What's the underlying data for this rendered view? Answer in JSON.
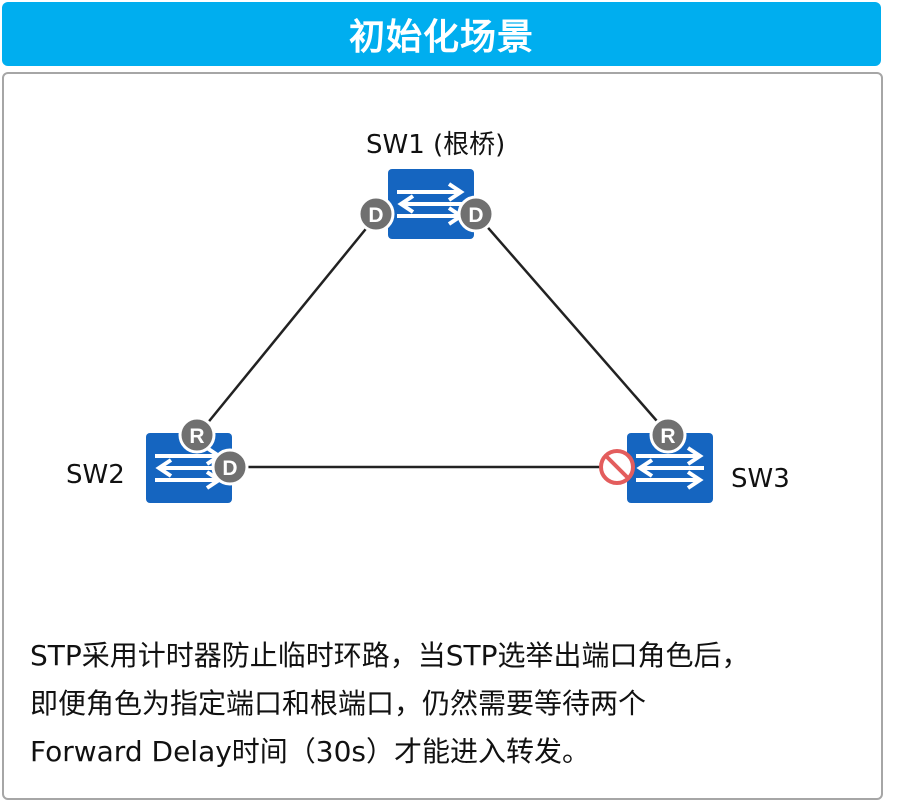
{
  "header": {
    "title": "初始化场景"
  },
  "diagram": {
    "switches": [
      {
        "id": "sw1",
        "label": "SW1 (根桥)",
        "icon": "switch-icon"
      },
      {
        "id": "sw2",
        "label": "SW2",
        "icon": "switch-icon"
      },
      {
        "id": "sw3",
        "label": "SW3",
        "icon": "switch-icon"
      }
    ],
    "port_roles": {
      "designated": "D",
      "root": "R",
      "blocked_icon": "blocked-icon"
    },
    "colors": {
      "switch": "#1565C0",
      "port_badge": "#707070",
      "blocked": "#E35D5D",
      "accent": "#00AEEF"
    }
  },
  "description": {
    "lines": [
      "STP采用计时器防止临时环路，当STP选举出端口角色后，",
      "即便角色为指定端口和根端口，仍然需要等待两个",
      "Forward Delay时间（30s）才能进入转发。"
    ]
  }
}
